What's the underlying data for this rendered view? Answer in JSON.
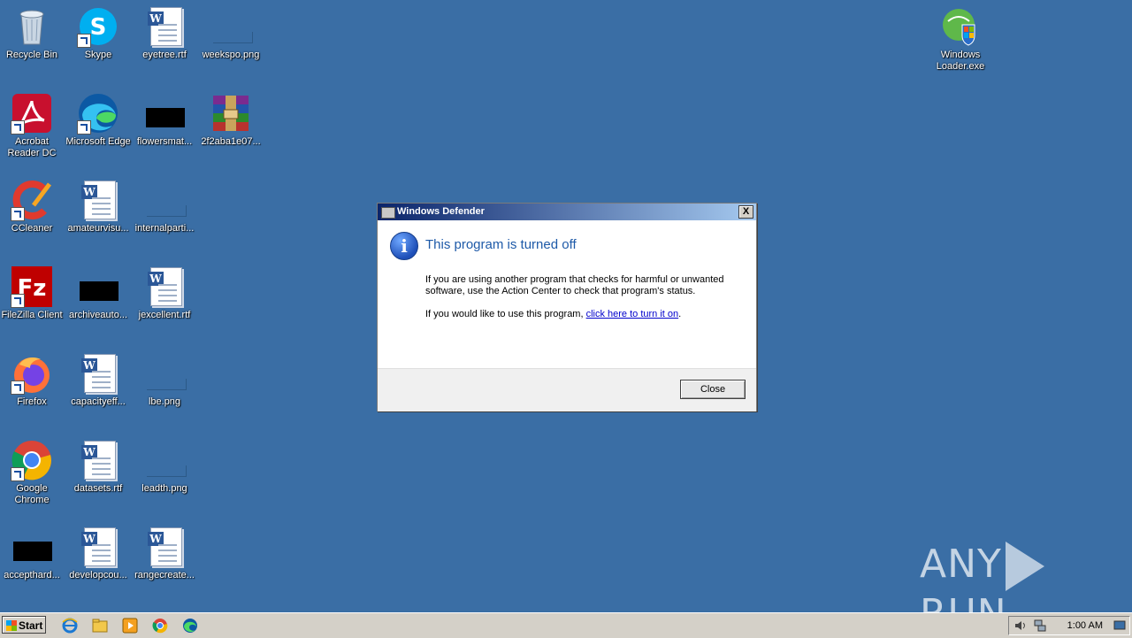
{
  "desktop": {
    "icons": {
      "recycle_bin": "Recycle Bin",
      "skype": "Skype",
      "eyetree": "eyetree.rtf",
      "weekspo": "weekspo.png",
      "acrobat": "Acrobat Reader DC",
      "edge": "Microsoft Edge",
      "flowersmat": "flowersmat...",
      "archive2f2": "2f2aba1e07...",
      "ccleaner": "CCleaner",
      "amateurvisu": "amateurvisu...",
      "internalparti": "internalparti...",
      "filezilla": "FileZilla Client",
      "archiveauto": "archiveauto...",
      "jexcellent": "jexcellent.rtf",
      "firefox": "Firefox",
      "capacityeff": "capacityeff...",
      "lbe": "lbe.png",
      "chrome": "Google Chrome",
      "datasets": "datasets.rtf",
      "leadth": "leadth.png",
      "accepthard": "accepthard...",
      "developcou": "developcou...",
      "rangecreate": "rangecreate...",
      "windows_loader": "Windows Loader.exe"
    }
  },
  "dialog": {
    "title": "Windows Defender",
    "heading": "This program is turned off",
    "para1": "If you are using another program that checks for harmful or unwanted software, use the Action Center to check that program's status.",
    "para2_prefix": "If you would like to use this program, ",
    "para2_link": "click here to turn it on",
    "para2_suffix": ".",
    "close_button": "Close",
    "close_x": "X"
  },
  "watermark": {
    "left": "ANY",
    "right": "RUN"
  },
  "taskbar": {
    "start_label": "Start",
    "time": "1:00 AM"
  },
  "colors": {
    "desktop_bg": "#3a6ea5",
    "heading": "#1e5aa8",
    "link": "#0000cc"
  }
}
